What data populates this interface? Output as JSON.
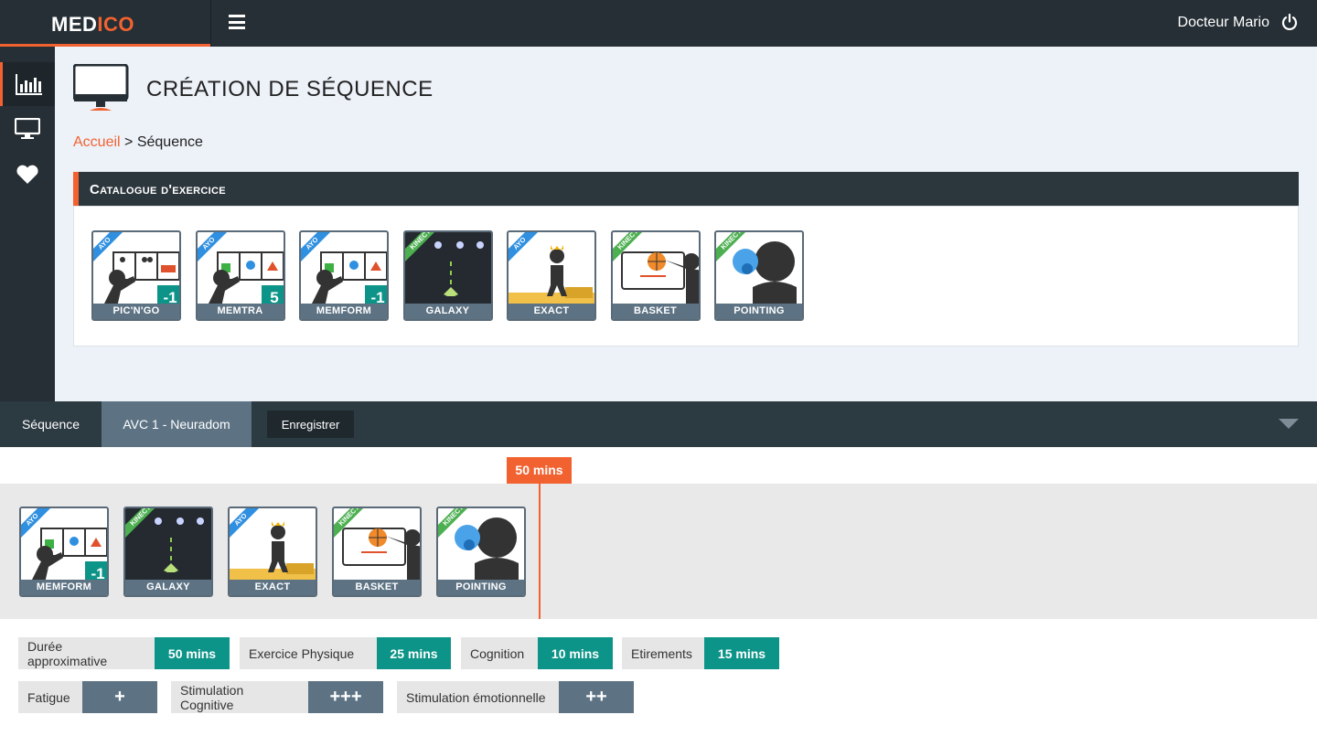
{
  "app": {
    "logo_a": "MED",
    "logo_b": "ICO",
    "user_name": "Docteur Mario"
  },
  "page": {
    "title": "CRÉATION DE SÉQUENCE",
    "breadcrumb_home": "Accueil",
    "breadcrumb_sep": ">",
    "breadcrumb_current": "Séquence"
  },
  "catalogue": {
    "title": "Catalogue d'exercice",
    "items": [
      {
        "label": "PIC'N'GO",
        "tag": "AYO",
        "badge": "-1"
      },
      {
        "label": "MEMTRA",
        "tag": "AYO",
        "badge": "5"
      },
      {
        "label": "MEMFORM",
        "tag": "AYO",
        "badge": "-1"
      },
      {
        "label": "GALAXY",
        "tag": "KINECT",
        "badge": ""
      },
      {
        "label": "EXACT",
        "tag": "AYO",
        "badge": ""
      },
      {
        "label": "BASKET",
        "tag": "KINECT",
        "badge": ""
      },
      {
        "label": "POINTING",
        "tag": "KINECT",
        "badge": ""
      }
    ]
  },
  "sequence": {
    "label": "Séquence",
    "name": "AVC 1 - Neuradom",
    "save_label": "Enregistrer",
    "time_marker": "50 mins",
    "items": [
      {
        "label": "MEMFORM",
        "tag": "AYO",
        "badge": "-1"
      },
      {
        "label": "GALAXY",
        "tag": "KINECT",
        "badge": ""
      },
      {
        "label": "EXACT",
        "tag": "AYO",
        "badge": ""
      },
      {
        "label": "BASKET",
        "tag": "KINECT",
        "badge": ""
      },
      {
        "label": "POINTING",
        "tag": "KINECT",
        "badge": ""
      }
    ]
  },
  "stats": {
    "duration": {
      "key": "Durée approximative",
      "value": "50 mins"
    },
    "physical": {
      "key": "Exercice Physique",
      "value": "25 mins"
    },
    "cognition": {
      "key": "Cognition",
      "value": "10 mins"
    },
    "stretch": {
      "key": "Etirements",
      "value": "15 mins"
    },
    "fatigue": {
      "key": "Fatigue",
      "value": "+"
    },
    "cog_stim": {
      "key": "Stimulation Cognitive",
      "value": "+++"
    },
    "emo_stim": {
      "key": "Stimulation émotionnelle",
      "value": "++"
    }
  },
  "colors": {
    "accent": "#f26230",
    "dark": "#262f35",
    "teal": "#0d9488",
    "slate": "#5d7384",
    "ayo": "#2f8fe0",
    "kinect": "#4caf50"
  }
}
